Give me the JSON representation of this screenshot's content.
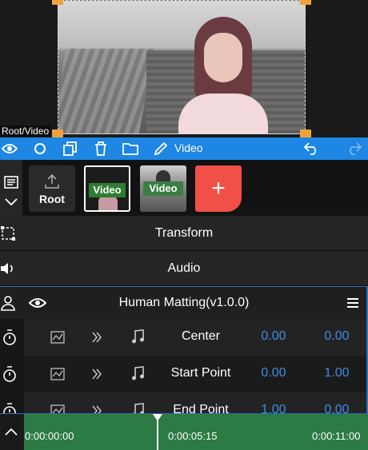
{
  "preview": {
    "path_label": "Root/Video"
  },
  "toolbar": {
    "mode_label": "Video",
    "icons": [
      "eye-icon",
      "circle-icon",
      "copy-icon",
      "trash-icon",
      "folder-icon",
      "pencil-icon",
      "undo-icon",
      "redo-icon"
    ]
  },
  "clips": [
    {
      "label": "Root",
      "icon": "upload-icon"
    },
    {
      "label": "Video",
      "selected": true
    },
    {
      "label": "Video",
      "selected": false
    },
    {
      "label": "+"
    }
  ],
  "sections": {
    "transform": "Transform",
    "audio": "Audio"
  },
  "panel": {
    "title": "Human Matting(v1.0.0)",
    "rows": [
      {
        "label": "Center",
        "v1": "0.00",
        "v2": "0.00"
      },
      {
        "label": "Start Point",
        "v1": "0.00",
        "v2": "1.00"
      },
      {
        "label": "End Point",
        "v1": "1.00",
        "v2": "0.00"
      }
    ]
  },
  "timeline": {
    "start": "0:00:00:00",
    "current": "0:00:05:15",
    "end": "0:00:11:00"
  },
  "colors": {
    "accent": "#1e86e3",
    "value": "#3d8de6",
    "add": "#f05045",
    "timeline": "#2c7a44"
  }
}
